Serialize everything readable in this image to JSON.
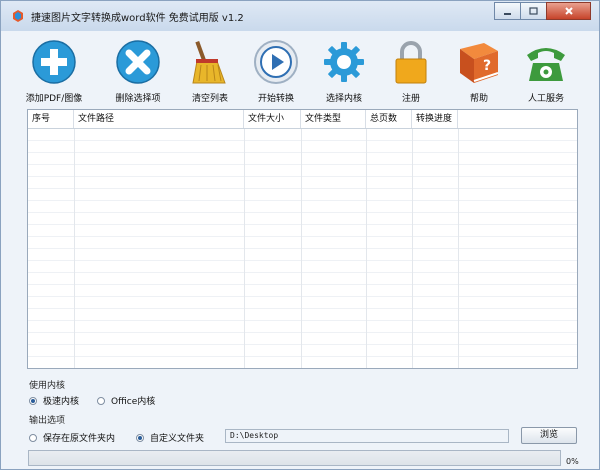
{
  "window": {
    "title": "捷速图片文字转换成word软件 免费试用版 v1.2"
  },
  "toolbar": [
    {
      "id": "add",
      "label": "添加PDF/图像",
      "icon": "plus-circle-icon",
      "color": "#2b9ad8"
    },
    {
      "id": "remove",
      "label": "删除选择项",
      "icon": "x-circle-icon",
      "color": "#2b9ad8"
    },
    {
      "id": "clear",
      "label": "清空列表",
      "icon": "broom-icon",
      "color": "#d9a520"
    },
    {
      "id": "start",
      "label": "开始转换",
      "icon": "play-circle-icon",
      "color": "#2f6fb3"
    },
    {
      "id": "engine",
      "label": "选择内核",
      "icon": "gear-icon",
      "color": "#2b9ad8"
    },
    {
      "id": "register",
      "label": "注册",
      "icon": "lock-icon",
      "color": "#f0a81c"
    },
    {
      "id": "help",
      "label": "帮助",
      "icon": "help-book-icon",
      "color": "#e06a2c"
    },
    {
      "id": "service",
      "label": "人工服务",
      "icon": "telephone-icon",
      "color": "#3d9a3d"
    }
  ],
  "table": {
    "columns": [
      "序号",
      "文件路径",
      "文件大小",
      "文件类型",
      "总页数",
      "转换进度"
    ],
    "rows": []
  },
  "engine_section": {
    "title": "使用内核",
    "options": [
      {
        "label": "极速内核",
        "selected": true
      },
      {
        "label": "Office内核",
        "selected": false
      }
    ]
  },
  "output_section": {
    "title": "输出选项",
    "options": [
      {
        "label": "保存在原文件夹内",
        "selected": false
      },
      {
        "label": "自定义文件夹",
        "selected": true
      }
    ],
    "path": "D:\\Desktop",
    "browse_label": "浏览"
  },
  "progress": {
    "value": 0,
    "text": "0%"
  }
}
